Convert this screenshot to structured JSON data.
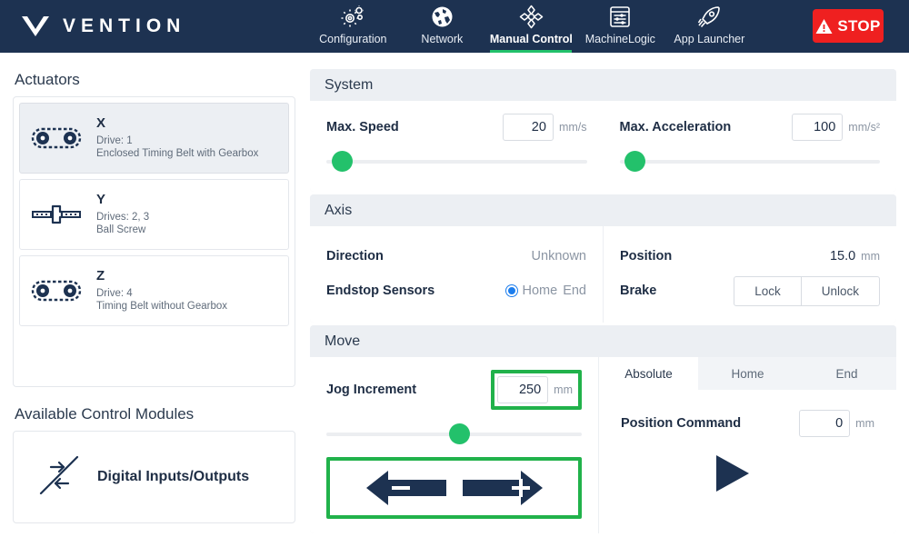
{
  "nav": {
    "brand": "VENTION",
    "items": [
      {
        "label": "Configuration",
        "icon": "gears-icon",
        "active": false
      },
      {
        "label": "Network",
        "icon": "globe-icon",
        "active": false
      },
      {
        "label": "Manual Control",
        "icon": "move-axis-icon",
        "active": true
      },
      {
        "label": "MachineLogic",
        "icon": "sliders-window-icon",
        "active": false
      },
      {
        "label": "App Launcher",
        "icon": "rocket-icon",
        "active": false
      }
    ],
    "stop_label": "STOP",
    "stop_color": "#ef2020",
    "accent_color": "#23c16b",
    "bar_color": "#1d3251"
  },
  "sidebar": {
    "actuators_title": "Actuators",
    "actuators": [
      {
        "name": "X",
        "drive": "Drive: 1",
        "type": "Enclosed Timing Belt with Gearbox",
        "icon": "timing-belt-icon",
        "selected": true
      },
      {
        "name": "Y",
        "drive": "Drives: 2, 3",
        "type": "Ball Screw",
        "icon": "ball-screw-icon",
        "selected": false
      },
      {
        "name": "Z",
        "drive": "Drive: 4",
        "type": "Timing Belt without Gearbox",
        "icon": "timing-belt-icon",
        "selected": false
      }
    ],
    "modules_title": "Available Control Modules",
    "modules": [
      {
        "label": "Digital Inputs/Outputs",
        "icon": "io-arrows-icon"
      }
    ]
  },
  "system": {
    "title": "System",
    "max_speed_label": "Max. Speed",
    "max_speed_value": "20",
    "max_speed_unit": "mm/s",
    "max_speed_slider_pct": 2,
    "max_accel_label": "Max. Acceleration",
    "max_accel_value": "100",
    "max_accel_unit": "mm/s²",
    "max_accel_slider_pct": 2
  },
  "axis": {
    "title": "Axis",
    "direction_label": "Direction",
    "direction_value": "Unknown",
    "endstop_label": "Endstop Sensors",
    "endstop_home": "Home",
    "endstop_end": "End",
    "endstop_selected": "Home",
    "position_label": "Position",
    "position_value": "15.0",
    "position_unit": "mm",
    "brake_label": "Brake",
    "brake_lock": "Lock",
    "brake_unlock": "Unlock"
  },
  "move": {
    "title": "Move",
    "jog_label": "Jog Increment",
    "jog_value": "250",
    "jog_unit": "mm",
    "jog_slider_pct": 48,
    "jog_minus_icon": "arrow-left-minus-icon",
    "jog_plus_icon": "arrow-right-plus-icon",
    "tabs": [
      {
        "label": "Absolute",
        "active": true
      },
      {
        "label": "Home",
        "active": false
      },
      {
        "label": "End",
        "active": false
      }
    ],
    "position_command_label": "Position Command",
    "position_command_value": "0",
    "position_command_unit": "mm",
    "play_icon": "play-icon",
    "stop_icon": "stop-square-icon",
    "highlight_color": "#21b24b"
  }
}
